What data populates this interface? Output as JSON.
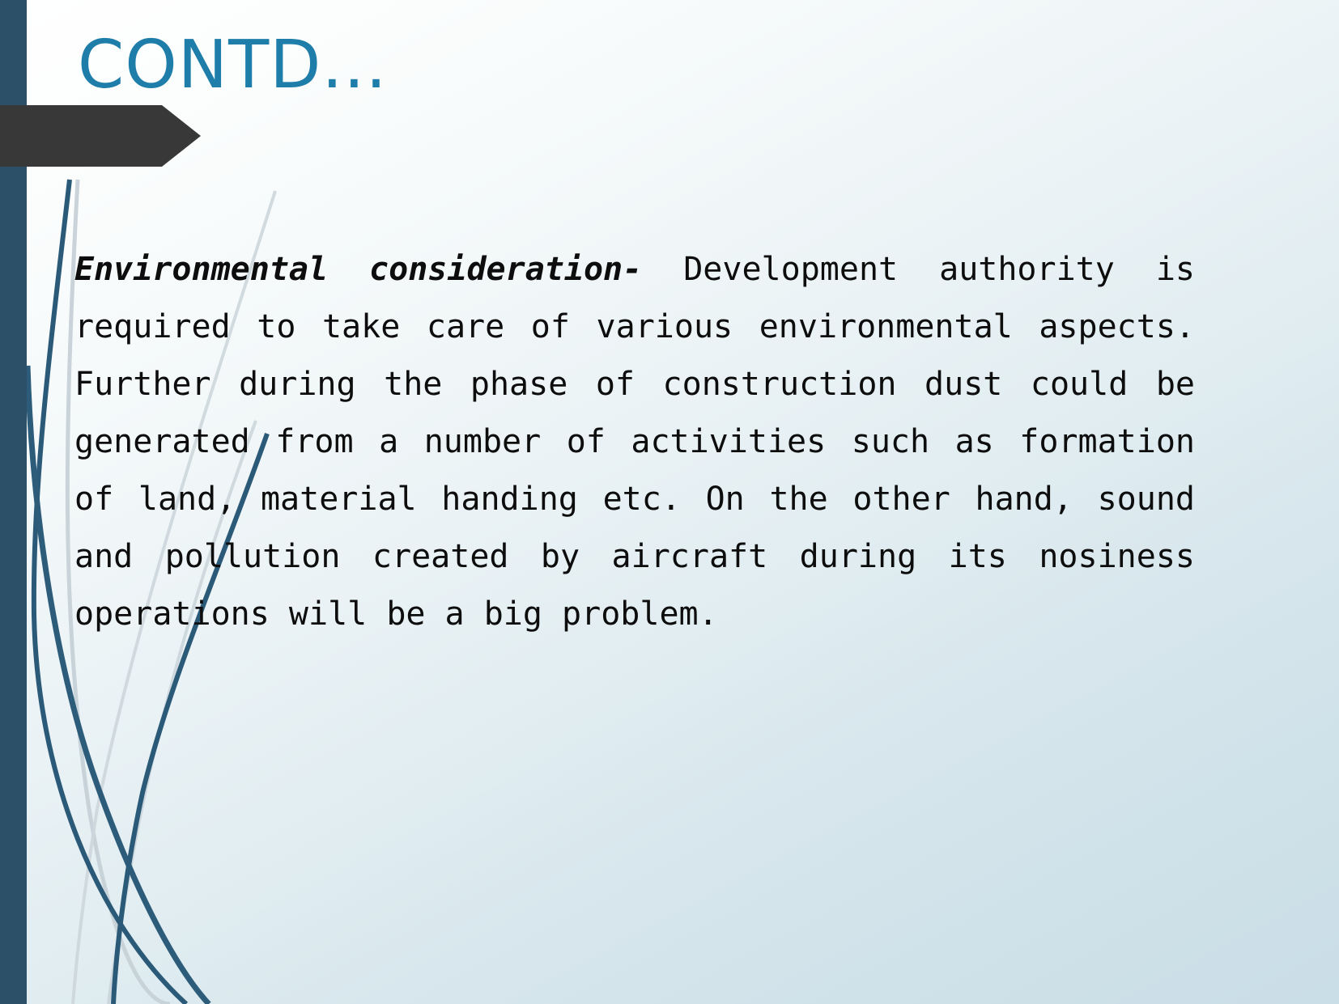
{
  "slide": {
    "title": "CONTD...",
    "title_color": "#1f7ea9",
    "background_top_color": "#ffffff",
    "background_bottom_color": "#cadee7",
    "left_bar_color": "#2b5068",
    "banner_color": "#383838",
    "body_text_color": "#0d0d0d"
  },
  "body": {
    "lead_in": "Environmental consideration-",
    "paragraph": " Development authority is required to take care of various environmental aspects. Further during the phase of construction dust could be generated from a number of activities such as formation of land, material handing etc. On the other hand, sound and pollution created by aircraft during its nosiness operations will be a big problem.",
    "full_text": "Environmental consideration- Development authority is required to take care of various environmental aspects. Further during the phase of construction dust could be generated from a number of activities such as formation of land, material handing etc. On the other hand, sound and pollution created by aircraft during its nosiness operations will be a big problem."
  },
  "decoration": {
    "reed_dark_color": "#2b5a78",
    "reed_light_color": "#c3ced4",
    "reed_count": 6
  }
}
